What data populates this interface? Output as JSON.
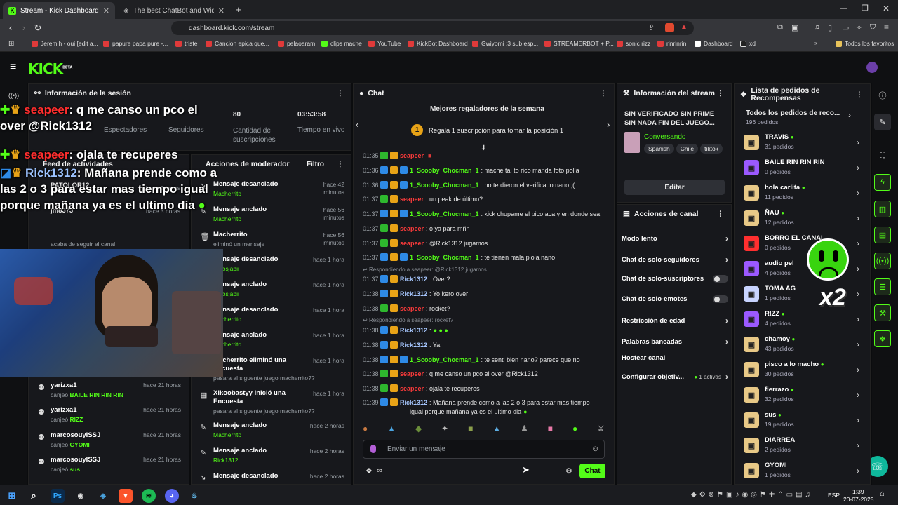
{
  "browser": {
    "tabs": [
      {
        "label": "Stream - Kick Dashboard",
        "icon": "kick-icon"
      },
      {
        "label": "The best ChatBot and Widgets fo",
        "icon": "kickbot-icon"
      }
    ],
    "new_tab": "+",
    "url": "dashboard.kick.com/stream",
    "bookmarks": [
      "Jeremih - oui [edit a...",
      "papure papa pure -...",
      "triste",
      "Cancion epica que...",
      "pelaoaram",
      "clips mache",
      "YouTube",
      "KickBot Dashboard",
      "Gwiyomi :3 sub esp...",
      "STREAMERBOT + P...",
      "sonic rizz",
      "rinrinrin",
      "Dashboard",
      "xd",
      "Todos los favoritos"
    ]
  },
  "app": {
    "logo": "KICK",
    "logo_sup": "BETA"
  },
  "session": {
    "title": "Información de la sesión",
    "stats": [
      {
        "value": "",
        "label": "Espectadores"
      },
      {
        "value": "",
        "label": "Seguidores"
      },
      {
        "value": "80",
        "label": "Cantidad de suscripciones"
      },
      {
        "value": "03:53:58",
        "label": "Tiempo en vivo"
      }
    ]
  },
  "overlay": {
    "lines": [
      {
        "user": "seapeer",
        "text": ": q me canso un pco el over @Rick1312",
        "color": "red"
      },
      {
        "user": "seapeer",
        "text": ": ojala te recuperes",
        "color": "red"
      },
      {
        "user": "Rick1312",
        "text": ": Mañana prende como a las 2 o 3 para estar mas tiempo igual porque mañana ya es el ultimo dia",
        "color": "blue"
      }
    ],
    "partial_under": "PATOLOR12",
    "partial_under2": "jm8373",
    "partial_time": "hace 3 horas",
    "partial_time2": "hace 3 horas",
    "partial_sub": "acaba de seguir el canal"
  },
  "feed": {
    "title": "Feed de actividades",
    "rows": [
      {
        "user": "yarizxa1",
        "action": "canjeó",
        "reward": "BAILE RIN RIN RIN",
        "time": "hace 21 horas"
      },
      {
        "user": "yarizxa1",
        "action": "canjeó",
        "reward": "RIZZ",
        "time": "hace 21 horas"
      },
      {
        "user": "marcosouyISSJ",
        "action": "canjeó",
        "reward": "GYOMI",
        "time": "hace 21 horas"
      },
      {
        "user": "marcosouyISSJ",
        "action": "canjeó",
        "reward": "sus",
        "time": "hace 21 horas"
      }
    ]
  },
  "mod": {
    "title": "Acciones de moderador",
    "filter": "Filtro",
    "rows": [
      {
        "a": "Mensaje desanclado",
        "b": "Macherrito",
        "c": "hace 42 minutos",
        "icon": "unpin-icon"
      },
      {
        "a": "Mensaje anclado",
        "b": "Macherrito",
        "c": "hace 56 minutos",
        "icon": "pin-icon"
      },
      {
        "a": "Macherrito",
        "b": "eliminó un mensaje",
        "c": "hace 56 minutos",
        "icon": "trash-icon"
      },
      {
        "a": "Mensaje desanclado",
        "b": "Whosjabii",
        "c": "hace 1 hora",
        "icon": "unpin-icon"
      },
      {
        "a": "Mensaje anclado",
        "b": "Whosjabii",
        "c": "hace 1 hora",
        "icon": "pin-icon"
      },
      {
        "a": "Mensaje desanclado",
        "b": "Macherrito",
        "c": "hace 1 hora",
        "icon": "unpin-icon"
      },
      {
        "a": "Mensaje anclado",
        "b": "Macherrito",
        "c": "hace 1 hora",
        "icon": "pin-icon"
      },
      {
        "a": "Macherrito eliminó una Encuesta",
        "b": "pasara al siguente juego macherrito??",
        "c": "hace 1 hora",
        "icon": "poll-icon"
      },
      {
        "a": "Xlkoobastyy inició una Encuesta",
        "b": "pasara al siguente juego macherrito??",
        "c": "hace 1 hora",
        "icon": "poll-icon"
      },
      {
        "a": "Mensaje anclado",
        "b": "Macherrito",
        "c": "hace 2 horas",
        "icon": "pin-icon"
      },
      {
        "a": "Mensaje anclado",
        "b": "Rick1312",
        "c": "hace 2 horas",
        "icon": "pin-icon"
      },
      {
        "a": "Mensaje desanclado",
        "b": "",
        "c": "hace 2 horas",
        "icon": "unpin-icon"
      }
    ]
  },
  "chat": {
    "title": "Chat",
    "gifters_title": "Mejores regaladores de la semana",
    "gifters_cta": "Regala 1 suscripción para tomar la posición 1",
    "gifters_rank": "1",
    "messages": [
      {
        "t": "01:35",
        "u": "seapeer",
        "c": "red",
        "m": ""
      },
      {
        "t": "01:36",
        "u": "1_Scooby_Chocman_1",
        "c": "green",
        "m": ": mache tai to rico manda foto polla"
      },
      {
        "t": "01:36",
        "u": "1_Scooby_Chocman_1",
        "c": "green",
        "m": ": no te dieron el verificado nano ;("
      },
      {
        "t": "01:37",
        "u": "seapeer",
        "c": "red",
        "m": ": un peak de último?"
      },
      {
        "t": "01:37",
        "u": "1_Scooby_Chocman_1",
        "c": "green",
        "m": ": kick chupame el pico aca y en donde sea"
      },
      {
        "t": "01:37",
        "u": "seapeer",
        "c": "red",
        "m": ": o ya para mñn"
      },
      {
        "t": "01:37",
        "u": "seapeer",
        "c": "red",
        "m": ": @Rick1312 jugamos"
      },
      {
        "t": "01:37",
        "u": "1_Scooby_Chocman_1",
        "c": "green",
        "m": ": te tienen mala piola nano"
      },
      {
        "t": "01:37",
        "u": "Rick1312",
        "c": "blue",
        "m": ": Over?",
        "reply": "Respondiendo a seapeer: @Rick1312 jugamos"
      },
      {
        "t": "01:38",
        "u": "Rick1312",
        "c": "blue",
        "m": ": Yo kero over"
      },
      {
        "t": "01:38",
        "u": "seapeer",
        "c": "red",
        "m": ": rocket?"
      },
      {
        "t": "01:38",
        "u": "Rick1312",
        "c": "blue",
        "m": ":",
        "reply": "Respondiendo a seapeer: rocket?"
      },
      {
        "t": "01:38",
        "u": "Rick1312",
        "c": "blue",
        "m": ": Ya"
      },
      {
        "t": "01:38",
        "u": "1_Scooby_Chocman_1",
        "c": "green",
        "m": ": te senti bien nano? parece que no"
      },
      {
        "t": "01:38",
        "u": "seapeer",
        "c": "red",
        "m": ": q me canso un pco el over @Rick1312"
      },
      {
        "t": "01:38",
        "u": "seapeer",
        "c": "red",
        "m": ": ojala te recuperes"
      },
      {
        "t": "01:39",
        "u": "Rick1312",
        "c": "blue",
        "m": ": Mañana prende como a las 2 o 3 para estar mas tiempo"
      },
      {
        "t": "",
        "u": "",
        "c": "",
        "m": "igual porque mañana ya es el ultimo dia"
      }
    ],
    "placeholder": "Enviar un mensaje",
    "send": "Chat"
  },
  "stream_info": {
    "title": "Información del stream",
    "stream_title": "SIN VERIFICADO SIN PRIME SIN NADA FIN DEL JUEGO...",
    "category": "Conversando",
    "tags": [
      "Spanish",
      "Chile",
      "tiktok"
    ],
    "edit": "Editar"
  },
  "channel": {
    "title": "Acciones de canal",
    "rows": [
      {
        "label": "Modo lento",
        "kind": "chevron"
      },
      {
        "label": "Chat de solo-seguidores",
        "kind": "chevron"
      },
      {
        "label": "Chat de solo-suscriptores",
        "kind": "toggle"
      },
      {
        "label": "Chat de solo-emotes",
        "kind": "toggle"
      },
      {
        "label": "Restricción de edad",
        "kind": "chevron"
      },
      {
        "label": "Palabras baneadas",
        "kind": "chevron"
      },
      {
        "label": "Hostear canal",
        "kind": "none"
      },
      {
        "label": "Configurar objetiv...",
        "kind": "chevron",
        "extra": "1 activas"
      }
    ]
  },
  "requests": {
    "title": "Lista de pedidos de Recompensas",
    "all_label": "Todos los pedidos de reco...",
    "all_count": "196 pedidos",
    "items": [
      {
        "name": "TRAVIS",
        "count": "31 pedidos",
        "color": "#e8c987",
        "dot": true
      },
      {
        "name": "BAILE RIN RIN RIN",
        "count": "0 pedidos",
        "color": "#9b59ff",
        "dot": false
      },
      {
        "name": "hola carlita",
        "count": "11 pedidos",
        "color": "#e8c987",
        "dot": true
      },
      {
        "name": "ÑAU",
        "count": "12 pedidos",
        "color": "#e8c987",
        "dot": true
      },
      {
        "name": "BORRO EL CANAL",
        "count": "0 pedidos",
        "color": "#ff2f2f",
        "dot": false
      },
      {
        "name": "audio pel",
        "count": "4 pedidos",
        "color": "#9b59ff",
        "dot": false
      },
      {
        "name": "TOMA AG",
        "count": "1 pedidos",
        "color": "#c8d4ff",
        "dot": false
      },
      {
        "name": "RIZZ",
        "count": "4 pedidos",
        "color": "#9b59ff",
        "dot": true
      },
      {
        "name": "chamoy",
        "count": "43 pedidos",
        "color": "#e8c987",
        "dot": true
      },
      {
        "name": "pisco a lo macho",
        "count": "30 pedidos",
        "color": "#e8c987",
        "dot": true
      },
      {
        "name": "fierrazo",
        "count": "32 pedidos",
        "color": "#e8c987",
        "dot": true
      },
      {
        "name": "sus",
        "count": "19 pedidos",
        "color": "#e8c987",
        "dot": true
      },
      {
        "name": "DIARREA",
        "count": "2 pedidos",
        "color": "#e8c987",
        "dot": false
      },
      {
        "name": "GYOMI",
        "count": "1 pedidos",
        "color": "#e8c987",
        "dot": false
      }
    ],
    "sticker": "x2"
  },
  "taskbar": {
    "lang": "ESP",
    "time": "1:39",
    "date": "20-07-2025"
  }
}
